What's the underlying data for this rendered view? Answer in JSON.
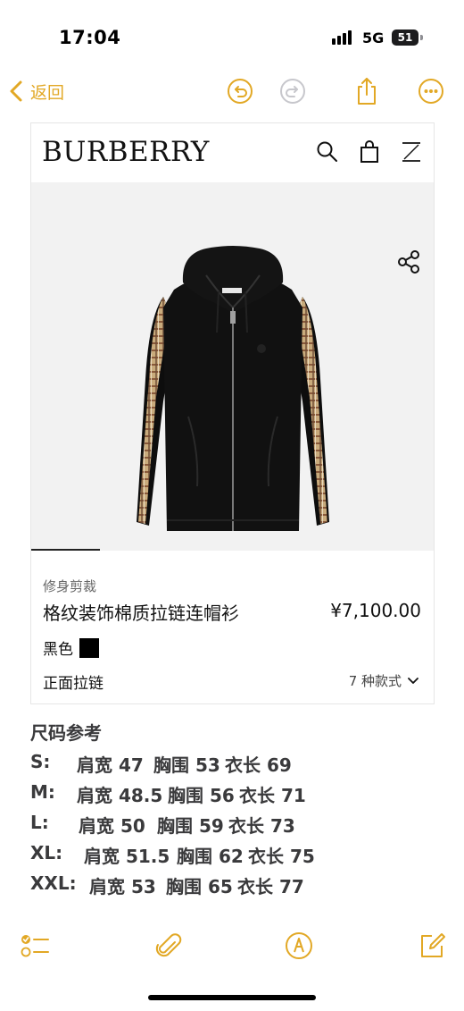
{
  "status_bar": {
    "time": "17:04",
    "network": "5G",
    "battery": "51"
  },
  "nav": {
    "back_label": "返回"
  },
  "product_page": {
    "brand": "BURBERRY",
    "fit": "修身剪裁",
    "name": "格纹装饰棉质拉链连帽衫",
    "price": "¥7,100.00",
    "color": "黑色",
    "closure": "正面拉链",
    "variants": "7 种款式"
  },
  "size_chart": {
    "title": "尺码参考",
    "rows": [
      {
        "size": "S:",
        "shoulder": "肩宽 47",
        "chest": "胸围 53",
        "length": "衣长 69"
      },
      {
        "size": "M:",
        "shoulder": "肩宽 48.5",
        "chest": "胸围 56",
        "length": "衣长 71"
      },
      {
        "size": "L:",
        "shoulder": "肩宽 50",
        "chest": "胸围 59",
        "length": "衣长 73"
      },
      {
        "size": "XL:",
        "shoulder": "肩宽 51.5",
        "chest": "胸围 62",
        "length": "衣长 75"
      },
      {
        "size": "XXL:",
        "shoulder": "肩宽 53",
        "chest": "胸围 65",
        "length": "衣长 77"
      }
    ]
  },
  "colors": {
    "accent": "#E2A825",
    "note_text": "#3A3A3C"
  },
  "icons": [
    "chevron-left-icon",
    "undo-icon",
    "redo-icon",
    "share-icon",
    "more-icon",
    "search-icon",
    "shopping-bag-icon",
    "menu-icon",
    "share-nodes-icon",
    "chevron-down-icon",
    "checklist-icon",
    "paperclip-icon",
    "markup-pen-icon",
    "compose-icon"
  ]
}
